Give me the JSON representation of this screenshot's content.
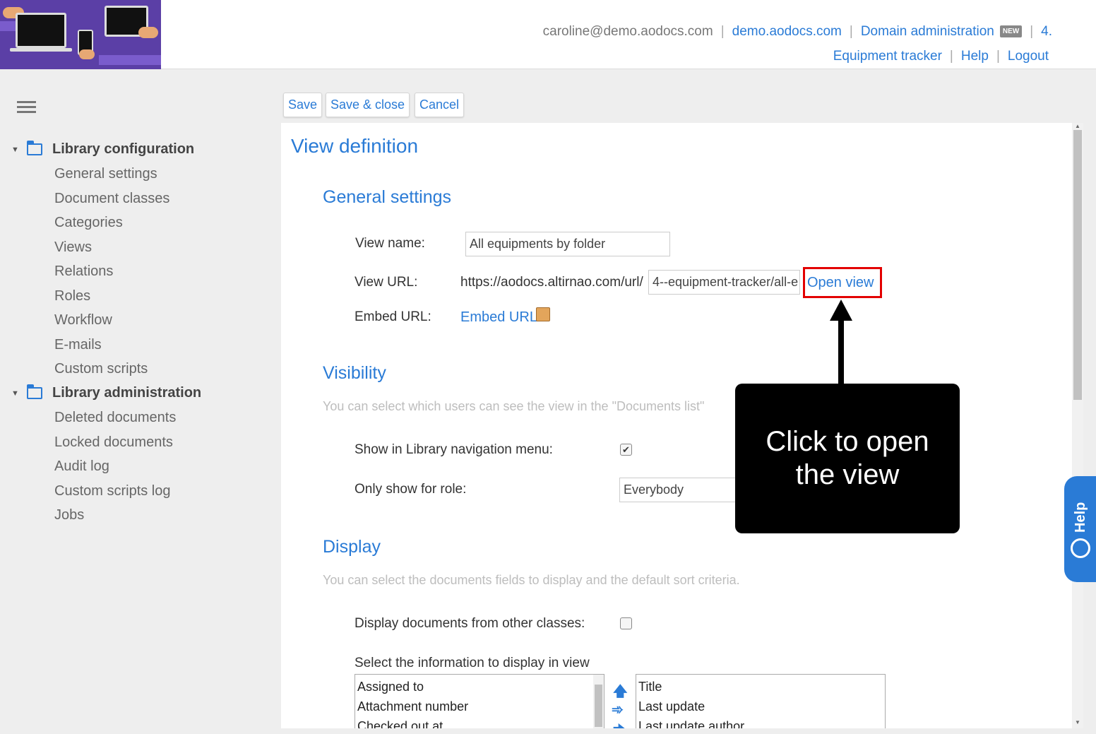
{
  "header": {
    "user_email": "caroline@demo.aodocs.com",
    "domain_link": "demo.aodocs.com",
    "domain_admin": "Domain administration",
    "new_badge": "NEW",
    "truncated_item": "4.",
    "library_name": "Equipment tracker",
    "help": "Help",
    "logout": "Logout"
  },
  "sidebar": {
    "sections": [
      {
        "title": "Library configuration",
        "items": [
          "General settings",
          "Document classes",
          "Categories",
          "Views",
          "Relations",
          "Roles",
          "Workflow",
          "E-mails",
          "Custom scripts"
        ]
      },
      {
        "title": "Library administration",
        "items": [
          "Deleted documents",
          "Locked documents",
          "Audit log",
          "Custom scripts log",
          "Jobs"
        ]
      }
    ]
  },
  "toolbar": {
    "save": "Save",
    "save_close": "Save & close",
    "cancel": "Cancel"
  },
  "main": {
    "title": "View definition",
    "general": {
      "heading": "General settings",
      "view_name_label": "View name:",
      "view_name_value": "All equipments by folder",
      "view_url_label": "View URL:",
      "view_url_prefix": "https://aodocs.altirnao.com/url/",
      "view_url_value": "4--equipment-tracker/all-e",
      "open_view": "Open view",
      "embed_label": "Embed URL:",
      "embed_link": "Embed URL"
    },
    "visibility": {
      "heading": "Visibility",
      "desc": "You can select which users can see the view in the \"Documents list\"",
      "show_nav_label": "Show in Library navigation menu:",
      "show_nav_checked": true,
      "role_label": "Only show for role:",
      "role_value": "Everybody"
    },
    "display": {
      "heading": "Display",
      "desc": "You can select the documents fields to display and the default sort criteria.",
      "other_classes_label": "Display documents from other classes:",
      "other_classes_checked": false,
      "select_info_label": "Select the information to display in view",
      "available": [
        "Assigned to",
        "Attachment number",
        "Checked out at"
      ],
      "selected": [
        "Title",
        "Last update",
        "Last update author"
      ]
    }
  },
  "callout": {
    "text": "Click to open the view"
  },
  "help_tab": {
    "label": "Help"
  },
  "colors": {
    "accent": "#2a7bd6",
    "highlight": "#e30000",
    "logo_bg": "#5b3fa6"
  }
}
